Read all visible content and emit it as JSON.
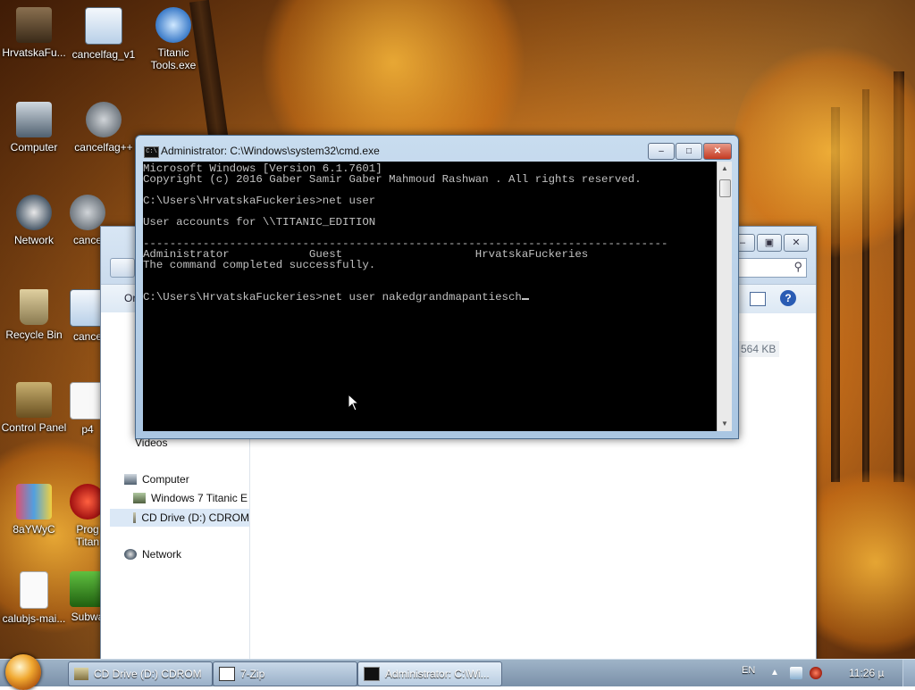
{
  "desktop": {
    "icons": [
      {
        "label": "HrvatskaFu...",
        "icon": "folder-icon"
      },
      {
        "label": "cancelfag_v1",
        "icon": "document-icon"
      },
      {
        "label": "Titanic Tools.exe",
        "icon": "application-icon"
      },
      {
        "label": "Computer",
        "icon": "computer-icon"
      },
      {
        "label": "cancelfag++",
        "icon": "gears-icon"
      },
      {
        "label": "Network",
        "icon": "network-icon"
      },
      {
        "label": "cance",
        "icon": "gears-icon"
      },
      {
        "label": "Recycle Bin",
        "icon": "recycle-bin-icon"
      },
      {
        "label": "cance",
        "icon": "document-icon"
      },
      {
        "label": "Control Panel",
        "icon": "control-panel-icon"
      },
      {
        "label": "p4",
        "icon": "image-icon"
      },
      {
        "label": "8aYWyC",
        "icon": "image-icon"
      },
      {
        "label": "Prog Titan",
        "icon": "application-icon"
      },
      {
        "label": "calubjs-mai...",
        "icon": "file-icon"
      },
      {
        "label": "Subwa",
        "icon": "game-icon"
      }
    ]
  },
  "explorer": {
    "toolbar_organize": "Or",
    "nav": {
      "videos": "Videos",
      "computer": "Computer",
      "drive_c": "Windows 7 Titanic E",
      "drive_d": "CD Drive (D:) CDROM",
      "network": "Network"
    },
    "size_label": "564 KB"
  },
  "cmd": {
    "title": "Administrator: C:\\Windows\\system32\\cmd.exe",
    "lines": [
      "Microsoft Windows [Version 6.1.7601]",
      "Copyright (c) 2016 Gaber Samir Gaber Mahmoud Rashwan . All rights reserved.",
      "",
      "C:\\Users\\HrvatskaFuckeries>net user",
      "",
      "User accounts for \\\\TITANIC_EDITION",
      "",
      "-------------------------------------------------------------------------------",
      "Administrator            Guest                    HrvatskaFuckeries",
      "The command completed successfully.",
      "",
      "",
      "C:\\Users\\HrvatskaFuckeries>net user nakedgrandmapantiesch"
    ]
  },
  "taskbar": {
    "buttons": [
      {
        "label": "CD Drive (D:) CDROM",
        "icon": "drive-icon"
      },
      {
        "label": "7-Zip",
        "icon": "archive-icon"
      },
      {
        "label": "Administrator: C:\\Wi...",
        "icon": "cmd-icon"
      }
    ],
    "language": "EN",
    "clock": "11:26 µ"
  }
}
